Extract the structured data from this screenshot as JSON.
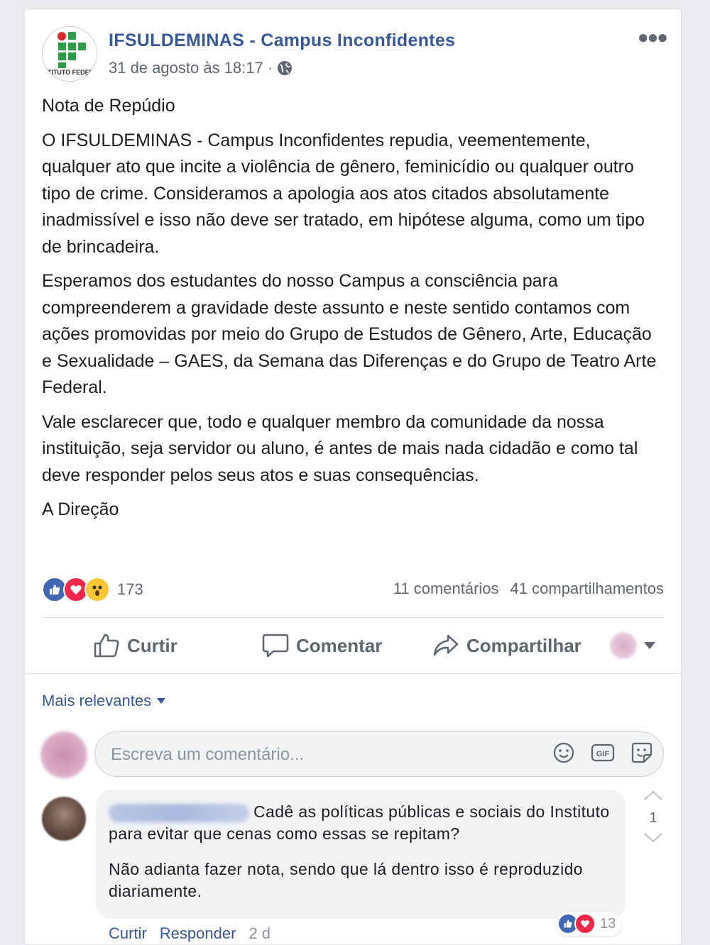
{
  "post": {
    "page_name": "IFSULDEMINAS - Campus Inconfidentes",
    "logo_text": "INSTITUTO FEDERAL",
    "timestamp": "31 de agosto às 18:17 ·",
    "privacy_icon": "globe-icon",
    "more_icon": "more-dots-icon",
    "title": "Nota de Repúdio",
    "paragraphs": [
      "O IFSULDEMINAS - Campus Inconfidentes repudia, veementemente, qualquer ato que incite a violência de gênero, feminicídio ou qualquer outro tipo de crime. Consideramos a apologia aos atos citados absolutamente inadmissível e isso não deve ser tratado, em hipótese alguma, como um tipo de brincadeira.",
      "Esperamos dos estudantes do nosso Campus a consciência para compreenderem a gravidade deste assunto e neste sentido contamos com ações promovidas por meio do Grupo de Estudos de Gênero, Arte, Educação e Sexualidade – GAES, da Semana das Diferenças e do Grupo de Teatro Arte Federal.",
      "Vale esclarecer que, todo e qualquer membro da comunidade da nossa instituição, seja servidor ou aluno, é antes de mais nada cidadão e como tal deve responder pelos seus atos e suas consequências."
    ],
    "signature": "A Direção"
  },
  "reactions": {
    "types": [
      "like",
      "love",
      "wow"
    ],
    "count": "173",
    "comments": "11 comentários",
    "shares": "41 compartilhamentos"
  },
  "actions": {
    "like": "Curtir",
    "comment": "Comentar",
    "share": "Compartilhar"
  },
  "comments_section": {
    "sort_label": "Mais relevantes",
    "compose_placeholder": "Escreva um comentário...",
    "compose_icons": [
      "emoji-icon",
      "gif-icon",
      "sticker-icon"
    ],
    "comment": {
      "text_1": "Cadê as políticas públicas e sociais do Instituto para evitar que cenas como essas se repitam?",
      "text_2": "Não adianta fazer nota, sendo que lá dentro isso é reproduzido diariamente.",
      "reaction_count": "13",
      "vote_count": "1",
      "like_label": "Curtir",
      "reply_label": "Responder",
      "age": "2 d"
    }
  },
  "colors": {
    "link_blue": "#385898",
    "like_blue": "#4267b2",
    "love_red": "#f0284a",
    "wow_yellow": "#fcc636",
    "text": "#1c1e21",
    "muted": "#616770"
  }
}
